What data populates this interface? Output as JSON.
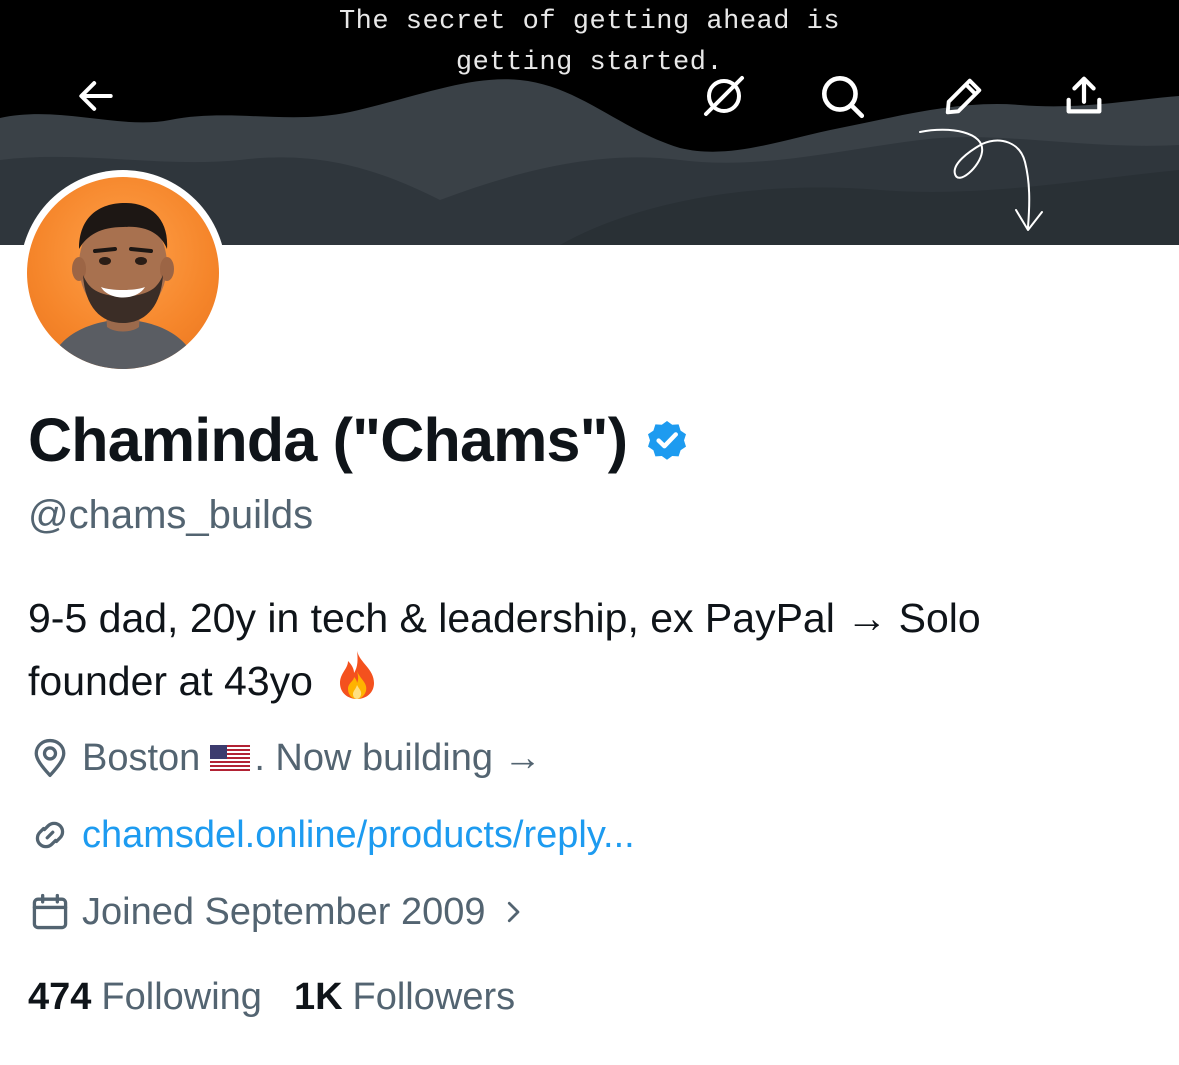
{
  "banner": {
    "quote_line1": "The secret of getting ahead is",
    "quote_line2": "getting started."
  },
  "toolbar": {
    "back_icon": "arrow-left-icon",
    "mute_icon": "bell-off-icon",
    "search_icon": "search-icon",
    "edit_icon": "pencil-icon",
    "share_icon": "share-icon"
  },
  "profile": {
    "name": "Chaminda (\"Chams\")",
    "handle": "@chams_builds",
    "bio_line1": "9-5 dad, 20y in tech & leadership, ex PayPal → Solo",
    "bio_line2": "founder at 43yo",
    "location_pre": "Boston",
    "location_post": ". Now building →",
    "website": "chamsdel.online/products/reply...",
    "joined": "Joined September 2009"
  },
  "stats": {
    "following_count": "474",
    "following_label": "Following",
    "followers_count": "1K",
    "followers_label": "Followers"
  },
  "colors": {
    "accent": "#1d9bf0",
    "verified": "#1d9bf0",
    "secondary_text": "#536471",
    "primary_text": "#0f1419"
  }
}
